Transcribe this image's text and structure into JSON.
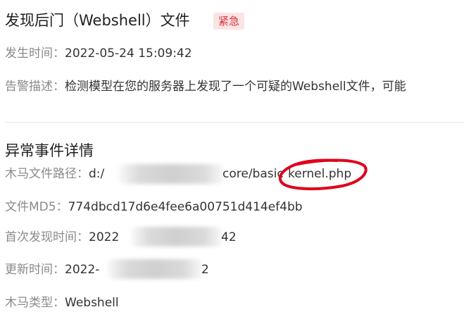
{
  "alert": {
    "title": "发现后门（Webshell）文件",
    "severity": "紧急",
    "time_label": "发生时间：",
    "time_value": "2022-05-24 15:09:42",
    "desc_label": "告警描述：",
    "desc_value": "检测模型在您的服务器上发现了一个可疑的Webshell文件，可能"
  },
  "details": {
    "section_title": "异常事件详情",
    "path_label": "木马文件路径：",
    "path_prefix": "d:/",
    "path_middle": "core/basic",
    "path_file": "kernel.php",
    "md5_label": "文件MD5：",
    "md5_value": "774dbcd17d6e4fee6a00751d414ef4bb",
    "first_found_label": "首次发现时间：",
    "first_found_prefix": "2022",
    "first_found_suffix": "42",
    "update_label": "更新时间：",
    "update_prefix": "2022-",
    "update_suffix": "2",
    "type_label": "木马类型：",
    "type_value": "Webshell"
  },
  "colors": {
    "badge_text": "#d9363e",
    "badge_bg": "#fbe4e4",
    "annotation_circle": "#e0001b"
  }
}
